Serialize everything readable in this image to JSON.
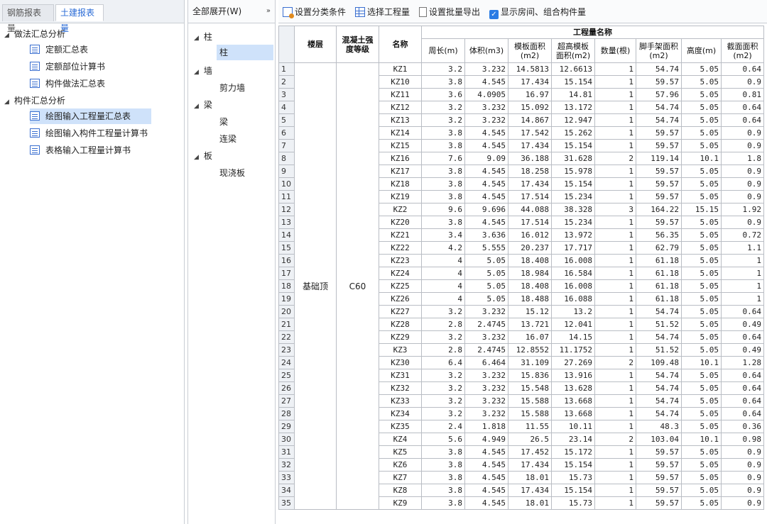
{
  "left_panel": {
    "tabs": [
      {
        "label": "钢筋报表量"
      },
      {
        "label": "土建报表量"
      }
    ],
    "tree": [
      {
        "label": "做法汇总分析",
        "children": [
          "定额汇总表",
          "定额部位计算书",
          "构件做法汇总表"
        ]
      },
      {
        "label": "构件汇总分析",
        "children": [
          "绘图输入工程量汇总表",
          "绘图输入构件工程量计算书",
          "表格输入工程量计算书"
        ]
      }
    ],
    "selected": "绘图输入工程量汇总表"
  },
  "mid_panel": {
    "dropdown": "全部展开(W)",
    "dropdown_icon": "double-chevron-right-icon",
    "groups": [
      {
        "label": "柱",
        "children": [
          "柱"
        ]
      },
      {
        "label": "墙",
        "children": [
          "剪力墙"
        ]
      },
      {
        "label": "梁",
        "children": [
          "梁",
          "连梁"
        ]
      },
      {
        "label": "板",
        "children": [
          "现浇板"
        ]
      }
    ]
  },
  "toolbar": {
    "set_category": "设置分类条件",
    "select_quantity": "选择工程量",
    "set_batch_export": "设置批量导出",
    "show_rooms": "显示房间、组合构件量",
    "show_rooms_checked": true
  },
  "table": {
    "headers": {
      "floor": "楼层",
      "grade": "混凝土强度等级",
      "name": "名称",
      "group": "工程量名称",
      "columns": [
        "周长(m)",
        "体积(m3)",
        "模板面积(m2)",
        "超高模板面积(m2)",
        "数量(根)",
        "脚手架面积(m2)",
        "高度(m)",
        "截面面积(m2)"
      ]
    },
    "floor": "基础顶",
    "grade": "C60",
    "rows": [
      [
        "KZ1",
        "3.2",
        "3.232",
        "14.5813",
        "12.6613",
        "1",
        "54.74",
        "5.05",
        "0.64"
      ],
      [
        "KZ10",
        "3.8",
        "4.545",
        "17.434",
        "15.154",
        "1",
        "59.57",
        "5.05",
        "0.9"
      ],
      [
        "KZ11",
        "3.6",
        "4.0905",
        "16.97",
        "14.81",
        "1",
        "57.96",
        "5.05",
        "0.81"
      ],
      [
        "KZ12",
        "3.2",
        "3.232",
        "15.092",
        "13.172",
        "1",
        "54.74",
        "5.05",
        "0.64"
      ],
      [
        "KZ13",
        "3.2",
        "3.232",
        "14.867",
        "12.947",
        "1",
        "54.74",
        "5.05",
        "0.64"
      ],
      [
        "KZ14",
        "3.8",
        "4.545",
        "17.542",
        "15.262",
        "1",
        "59.57",
        "5.05",
        "0.9"
      ],
      [
        "KZ15",
        "3.8",
        "4.545",
        "17.434",
        "15.154",
        "1",
        "59.57",
        "5.05",
        "0.9"
      ],
      [
        "KZ16",
        "7.6",
        "9.09",
        "36.188",
        "31.628",
        "2",
        "119.14",
        "10.1",
        "1.8"
      ],
      [
        "KZ17",
        "3.8",
        "4.545",
        "18.258",
        "15.978",
        "1",
        "59.57",
        "5.05",
        "0.9"
      ],
      [
        "KZ18",
        "3.8",
        "4.545",
        "17.434",
        "15.154",
        "1",
        "59.57",
        "5.05",
        "0.9"
      ],
      [
        "KZ19",
        "3.8",
        "4.545",
        "17.514",
        "15.234",
        "1",
        "59.57",
        "5.05",
        "0.9"
      ],
      [
        "KZ2",
        "9.6",
        "9.696",
        "44.088",
        "38.328",
        "3",
        "164.22",
        "15.15",
        "1.92"
      ],
      [
        "KZ20",
        "3.8",
        "4.545",
        "17.514",
        "15.234",
        "1",
        "59.57",
        "5.05",
        "0.9"
      ],
      [
        "KZ21",
        "3.4",
        "3.636",
        "16.012",
        "13.972",
        "1",
        "56.35",
        "5.05",
        "0.72"
      ],
      [
        "KZ22",
        "4.2",
        "5.555",
        "20.237",
        "17.717",
        "1",
        "62.79",
        "5.05",
        "1.1"
      ],
      [
        "KZ23",
        "4",
        "5.05",
        "18.408",
        "16.008",
        "1",
        "61.18",
        "5.05",
        "1"
      ],
      [
        "KZ24",
        "4",
        "5.05",
        "18.984",
        "16.584",
        "1",
        "61.18",
        "5.05",
        "1"
      ],
      [
        "KZ25",
        "4",
        "5.05",
        "18.408",
        "16.008",
        "1",
        "61.18",
        "5.05",
        "1"
      ],
      [
        "KZ26",
        "4",
        "5.05",
        "18.488",
        "16.088",
        "1",
        "61.18",
        "5.05",
        "1"
      ],
      [
        "KZ27",
        "3.2",
        "3.232",
        "15.12",
        "13.2",
        "1",
        "54.74",
        "5.05",
        "0.64"
      ],
      [
        "KZ28",
        "2.8",
        "2.4745",
        "13.721",
        "12.041",
        "1",
        "51.52",
        "5.05",
        "0.49"
      ],
      [
        "KZ29",
        "3.2",
        "3.232",
        "16.07",
        "14.15",
        "1",
        "54.74",
        "5.05",
        "0.64"
      ],
      [
        "KZ3",
        "2.8",
        "2.4745",
        "12.8552",
        "11.1752",
        "1",
        "51.52",
        "5.05",
        "0.49"
      ],
      [
        "KZ30",
        "6.4",
        "6.464",
        "31.109",
        "27.269",
        "2",
        "109.48",
        "10.1",
        "1.28"
      ],
      [
        "KZ31",
        "3.2",
        "3.232",
        "15.836",
        "13.916",
        "1",
        "54.74",
        "5.05",
        "0.64"
      ],
      [
        "KZ32",
        "3.2",
        "3.232",
        "15.548",
        "13.628",
        "1",
        "54.74",
        "5.05",
        "0.64"
      ],
      [
        "KZ33",
        "3.2",
        "3.232",
        "15.588",
        "13.668",
        "1",
        "54.74",
        "5.05",
        "0.64"
      ],
      [
        "KZ34",
        "3.2",
        "3.232",
        "15.588",
        "13.668",
        "1",
        "54.74",
        "5.05",
        "0.64"
      ],
      [
        "KZ35",
        "2.4",
        "1.818",
        "11.55",
        "10.11",
        "1",
        "48.3",
        "5.05",
        "0.36"
      ],
      [
        "KZ4",
        "5.6",
        "4.949",
        "26.5",
        "23.14",
        "2",
        "103.04",
        "10.1",
        "0.98"
      ],
      [
        "KZ5",
        "3.8",
        "4.545",
        "17.452",
        "15.172",
        "1",
        "59.57",
        "5.05",
        "0.9"
      ],
      [
        "KZ6",
        "3.8",
        "4.545",
        "17.434",
        "15.154",
        "1",
        "59.57",
        "5.05",
        "0.9"
      ],
      [
        "KZ7",
        "3.8",
        "4.545",
        "18.01",
        "15.73",
        "1",
        "59.57",
        "5.05",
        "0.9"
      ],
      [
        "KZ8",
        "3.8",
        "4.545",
        "17.434",
        "15.154",
        "1",
        "59.57",
        "5.05",
        "0.9"
      ],
      [
        "KZ9",
        "3.8",
        "4.545",
        "18.01",
        "15.73",
        "1",
        "59.57",
        "5.05",
        "0.9"
      ]
    ]
  }
}
